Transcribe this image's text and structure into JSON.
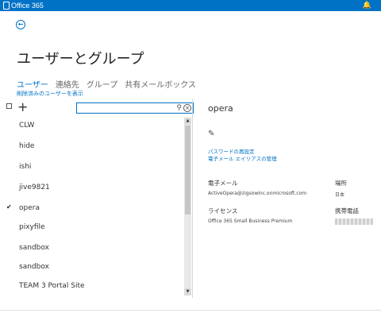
{
  "app": {
    "brand": "Office 365",
    "bell_icon": "bell-icon",
    "accent": "#0072c6"
  },
  "page": {
    "title": "ユーザーとグループ",
    "back_icon": "back-arrow-icon"
  },
  "tabs": [
    {
      "label": "ユーザー",
      "active": true
    },
    {
      "label": "連絡先",
      "active": false
    },
    {
      "label": "グループ",
      "active": false
    },
    {
      "label": "共有メールボックス",
      "active": false
    }
  ],
  "hidden_users_link": "削除済みのユーザーを表示",
  "toolbar": {
    "add_icon": "plus-icon",
    "search_value": "",
    "search_icon": "search-icon",
    "clear_icon": "clear-icon"
  },
  "list": {
    "items": [
      {
        "name": "CLW",
        "checked": false
      },
      {
        "name": "hide",
        "checked": false
      },
      {
        "name": "ishi",
        "checked": false
      },
      {
        "name": "jive9821",
        "checked": false
      },
      {
        "name": "opera",
        "checked": true
      },
      {
        "name": "pixyfile",
        "checked": false
      },
      {
        "name": "sandbox",
        "checked": false
      },
      {
        "name": "sandbox",
        "checked": false
      },
      {
        "name": "TEAM 3 Portal Site",
        "checked": false
      }
    ]
  },
  "detail": {
    "name": "opera",
    "edit_icon": "pencil-icon",
    "reset_password_link": "パスワードの再設定",
    "email_alias_link": "電子メール エイリアスの管理",
    "email_label": "電子メール",
    "email_value": "ActiveOpera@zigsowinc.onmicrosoft.com",
    "location_label": "場所",
    "location_value": "日本",
    "license_label": "ライセンス",
    "license_value": "Office 365 Small Business Premium",
    "mobile_label": "携帯電話"
  }
}
